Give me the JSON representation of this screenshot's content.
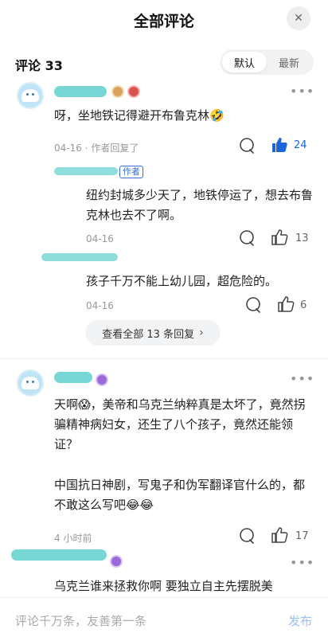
{
  "header": {
    "title": "全部评论",
    "close_glyph": "✕"
  },
  "comments_header": {
    "count_label": "评论 33",
    "sort_options": [
      "默认",
      "最新"
    ],
    "active_sort": "默认"
  },
  "comments": [
    {
      "text": "呀，坐地铁记得避开布鲁克林🤣",
      "date": "04-16",
      "meta_suffix": "· 作者回复了",
      "likes": "24",
      "liked": true,
      "replies": [
        {
          "author_tag": "作者",
          "text": "纽约封城多少天了，地铁停运了，想去布鲁克林也去不了啊。",
          "date": "04-16",
          "likes": "13"
        },
        {
          "text": "孩子千万不能上幼儿园，超危险的。",
          "date": "04-16",
          "likes": "6"
        }
      ],
      "view_all_label": "查看全部 13 条回复"
    },
    {
      "text": "天啊😱，美帝和乌克兰纳粹真是太坏了，竟然拐骗精神病妇女，还生了八个孩子，竟然还能领证？",
      "text2": "中国抗日神剧，写鬼子和伪军翻译官什么的，都不敢这么写吧😂😂",
      "date": "4 小时前",
      "likes": "17",
      "liked": false
    },
    {
      "text": "乌克兰谁来拯救你啊 要独立自主先摆脱美"
    }
  ],
  "input": {
    "placeholder": "评论千万条，友善第一条",
    "publish_label": "发布"
  },
  "colors": {
    "accent": "#1a66d8",
    "scribble": "#5fd0cc",
    "publish_disabled": "#9bc1f0"
  }
}
